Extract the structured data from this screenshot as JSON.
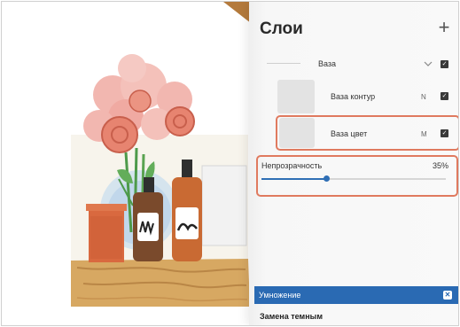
{
  "panel": {
    "title": "Слои",
    "add_icon": "plus-icon"
  },
  "layers": [
    {
      "label": "Ваза",
      "type": "group",
      "expanded": true,
      "visible": true
    },
    {
      "label": "Ваза контур",
      "blend_letter": "N",
      "visible": true
    },
    {
      "label": "Ваза цвет",
      "blend_letter": "M",
      "visible": true,
      "selected": true
    }
  ],
  "opacity": {
    "label": "Непрозрачность",
    "value_text": "35%",
    "value": 0.35
  },
  "blend_modes": {
    "selected": "Умножение",
    "next": "Замена темным"
  },
  "colors": {
    "accent": "#2a6ab3",
    "highlight": "#e07a5f"
  }
}
